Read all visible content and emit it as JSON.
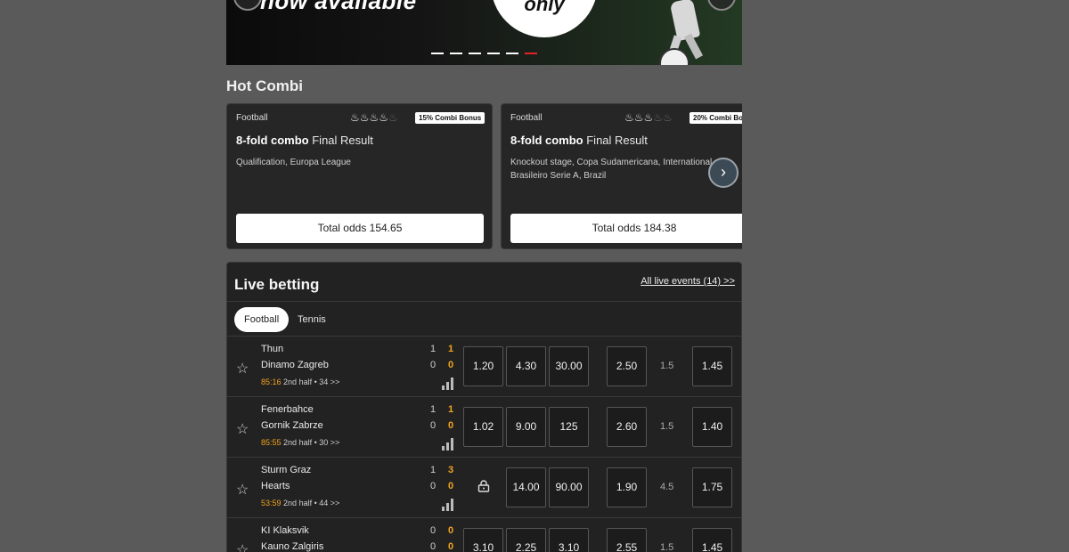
{
  "banner": {
    "headline": "now available",
    "circle_text": "only",
    "slides": 6,
    "active_slide": 6,
    "accent": "#e8202a"
  },
  "hot_combi": {
    "title": "Hot Combi",
    "next_icon": "chevron-right-icon",
    "cards": [
      {
        "sport": "Football",
        "flames_on": 4,
        "flames_total": 5,
        "bonus": "15% Combi Bonus",
        "fold": "8-fold combo",
        "market": "Final Result",
        "description": "Qualification, Europa League",
        "total": "Total odds 154.65"
      },
      {
        "sport": "Football",
        "flames_on": 3,
        "flames_total": 5,
        "bonus": "20% Combi Bo",
        "fold": "8-fold combo",
        "market": "Final Result",
        "description": "Knockout stage, Copa Sudamericana, International Brasileiro Serie A, Brazil",
        "total": "Total odds 184.38"
      }
    ]
  },
  "live": {
    "title": "Live betting",
    "all_link": "All live events (14) >>",
    "tabs": [
      "Football",
      "Tennis"
    ],
    "active_tab": "Football",
    "rows": [
      {
        "team1": "Thun",
        "team2": "Dinamo Zagreb",
        "time": "85:16",
        "period": "2nd half • 34 >>",
        "s1": "1",
        "s2": "0",
        "g1": "1",
        "g2": "0",
        "odds": [
          "1.20",
          "4.30",
          "30.00"
        ],
        "odd4": "2.50",
        "handicap": "1.5",
        "odd5": "1.45",
        "locked": false
      },
      {
        "team1": "Fenerbahce",
        "team2": "Gornik Zabrze",
        "time": "85:55",
        "period": "2nd half • 30 >>",
        "s1": "1",
        "s2": "0",
        "g1": "1",
        "g2": "0",
        "odds": [
          "1.02",
          "9.00",
          "125"
        ],
        "odd4": "2.60",
        "handicap": "1.5",
        "odd5": "1.40",
        "locked": false
      },
      {
        "team1": "Sturm Graz",
        "team2": "Hearts",
        "time": "53:59",
        "period": "2nd half • 44 >>",
        "s1": "1",
        "s2": "0",
        "g1": "3",
        "g2": "0",
        "odds": [
          "",
          "14.00",
          "90.00"
        ],
        "odd4": "1.90",
        "handicap": "4.5",
        "odd5": "1.75",
        "locked": true
      },
      {
        "team1": "KI Klaksvik",
        "team2": "Kauno Zalgiris",
        "time": "",
        "period": "",
        "s1": "0",
        "s2": "0",
        "g1": "0",
        "g2": "0",
        "odds": [
          "3.10",
          "2.25",
          "3.10"
        ],
        "odd4": "2.55",
        "handicap": "1.5",
        "odd5": "1.45",
        "locked": false
      }
    ]
  }
}
